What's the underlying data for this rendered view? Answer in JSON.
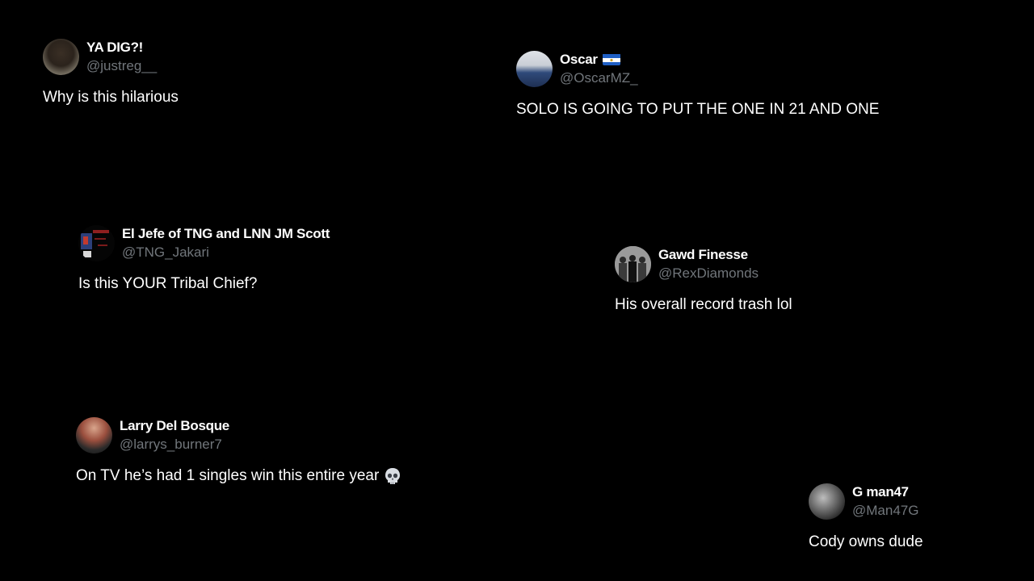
{
  "tweets": [
    {
      "display_name": "YA DIG?!",
      "handle": "@justreg__",
      "text": "Why is this hilarious",
      "avatar_icon": "user-avatar"
    },
    {
      "display_name": "Oscar",
      "handle": "@OscarMZ_",
      "text": "SOLO IS GOING TO PUT THE ONE IN 21 AND ONE",
      "avatar_icon": "user-avatar",
      "badge_icon": "el-salvador-flag-icon"
    },
    {
      "display_name": "El Jefe of TNG and LNN JM Scott",
      "handle": "@TNG_Jakari",
      "text": "Is this YOUR Tribal Chief?",
      "avatar_icon": "user-avatar"
    },
    {
      "display_name": "Gawd Finesse",
      "handle": "@RexDiamonds",
      "text": "His overall record trash lol",
      "avatar_icon": "user-avatar"
    },
    {
      "display_name": "Larry Del Bosque",
      "handle": "@larrys_burner7",
      "text": "On TV he’s had 1 singles win this entire year",
      "avatar_icon": "user-avatar",
      "emoji_icon": "skull-emoji-icon"
    },
    {
      "display_name": "G man47",
      "handle": "@Man47G",
      "text": "Cody owns dude",
      "avatar_icon": "user-avatar"
    }
  ],
  "colors": {
    "background": "#000000",
    "name": "#ffffff",
    "handle": "#71767b",
    "text": "#ffffff"
  }
}
